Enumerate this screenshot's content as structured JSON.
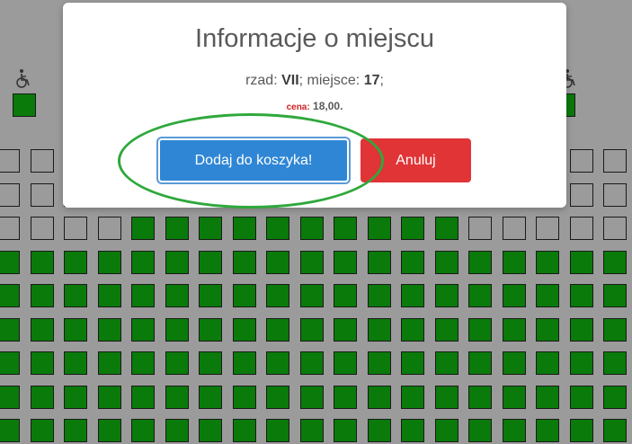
{
  "modal": {
    "title": "Informacje o miejscu",
    "row_label": "rzad:",
    "row_value": "VII",
    "seat_label": "miejsce:",
    "seat_value": "17",
    "price_label": "cena:",
    "price_value": "18,00."
  },
  "buttons": {
    "add_to_cart": "Dodaj do koszyka!",
    "cancel": "Anuluj"
  },
  "colors": {
    "free_seat": "#0a7a0a",
    "taken_seat": "#9b9b9b",
    "add_button": "#2f86d4",
    "cancel_button": "#e03436",
    "highlight": "#2fa83c"
  },
  "seat_map": {
    "rows": [
      [
        "taken",
        "taken",
        "taken",
        "taken",
        "taken",
        "taken",
        "taken",
        "taken",
        "taken",
        "taken",
        "taken",
        "taken",
        "taken",
        "taken",
        "taken",
        "taken",
        "taken",
        "taken",
        "taken"
      ],
      [
        "taken",
        "taken",
        "taken",
        "taken",
        "taken",
        "taken",
        "taken",
        "taken",
        "taken",
        "taken",
        "taken",
        "taken",
        "taken",
        "taken",
        "taken",
        "taken",
        "taken",
        "taken",
        "taken"
      ],
      [
        "taken",
        "taken",
        "taken",
        "taken",
        "free",
        "free",
        "free",
        "free",
        "free",
        "free",
        "free",
        "free",
        "free",
        "free",
        "taken",
        "taken",
        "taken",
        "taken",
        "taken"
      ],
      [
        "free",
        "free",
        "free",
        "free",
        "free",
        "free",
        "free",
        "free",
        "free",
        "free",
        "free",
        "free",
        "free",
        "free",
        "free",
        "free",
        "free",
        "free",
        "free"
      ],
      [
        "free",
        "free",
        "free",
        "free",
        "free",
        "free",
        "free",
        "free",
        "free",
        "free",
        "free",
        "free",
        "free",
        "free",
        "free",
        "free",
        "free",
        "free",
        "free"
      ],
      [
        "free",
        "free",
        "free",
        "free",
        "free",
        "free",
        "free",
        "free",
        "free",
        "free",
        "free",
        "free",
        "free",
        "free",
        "free",
        "free",
        "free",
        "free",
        "free"
      ],
      [
        "free",
        "free",
        "free",
        "free",
        "free",
        "free",
        "free",
        "free",
        "free",
        "free",
        "free",
        "free",
        "free",
        "free",
        "free",
        "free",
        "free",
        "free",
        "free"
      ],
      [
        "free",
        "free",
        "free",
        "free",
        "free",
        "free",
        "free",
        "free",
        "free",
        "free",
        "free",
        "free",
        "free",
        "free",
        "free",
        "free",
        "free",
        "free",
        "free"
      ],
      [
        "free",
        "free",
        "free",
        "free",
        "free",
        "free",
        "free",
        "free",
        "free",
        "free",
        "free",
        "free",
        "free",
        "free",
        "free",
        "free",
        "free",
        "free",
        "free"
      ]
    ],
    "wheelchair_seats": [
      "left",
      "right"
    ]
  }
}
